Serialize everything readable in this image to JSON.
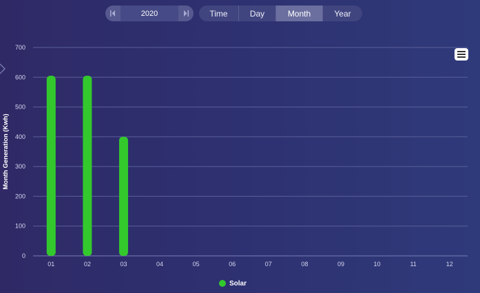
{
  "year_picker": {
    "year": "2020"
  },
  "tabs": [
    {
      "label": "Time",
      "active": false
    },
    {
      "label": "Day",
      "active": false
    },
    {
      "label": "Month",
      "active": true
    },
    {
      "label": "Year",
      "active": false
    }
  ],
  "icons": {
    "menu": "hamburger-menu-icon",
    "prev": "prev-year-icon",
    "next": "next-year-icon"
  },
  "colors": {
    "series": "#33c92d",
    "active_tab": "#6b6f9f"
  },
  "chart_data": {
    "type": "bar",
    "ylabel": "Month Generation (Kwh)",
    "categories": [
      "01",
      "02",
      "03",
      "04",
      "05",
      "06",
      "07",
      "08",
      "09",
      "10",
      "11",
      "12"
    ],
    "y_ticks": [
      "0",
      "100",
      "200",
      "300",
      "400",
      "500",
      "600",
      "700"
    ],
    "ylim": [
      0,
      700
    ],
    "grid": true,
    "legend_position": "bottom",
    "series": [
      {
        "name": "Solar",
        "color": "#33c92d",
        "values": [
          605,
          605,
          400,
          0,
          0,
          0,
          0,
          0,
          0,
          0,
          0,
          0
        ]
      }
    ]
  }
}
